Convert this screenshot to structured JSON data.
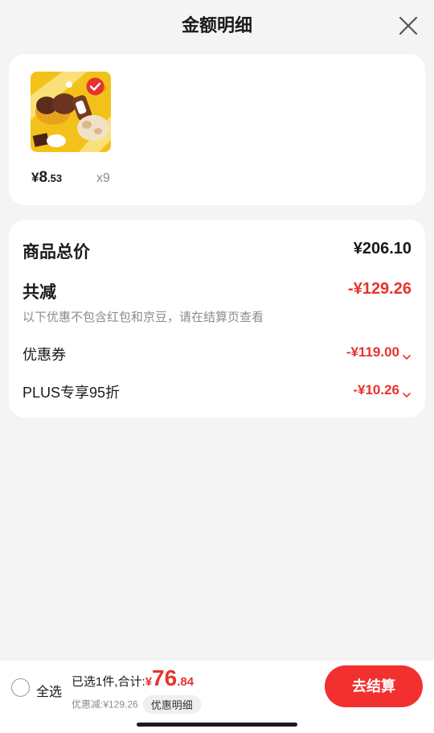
{
  "header": {
    "title": "金额明细",
    "close_icon": "close-icon"
  },
  "product": {
    "yuan_symbol": "¥",
    "price_int": "8",
    "price_dec": ".53",
    "quantity": "x9",
    "selected": true,
    "image_icon": "product-photo"
  },
  "summary": {
    "total_label": "商品总价",
    "total_value": "¥206.10",
    "discount_label": "共减",
    "discount_value": "-¥129.26",
    "discount_note": "以下优惠不包含红包和京豆，请在结算页查看",
    "coupon_label": "优惠券",
    "coupon_value": "-¥119.00",
    "plus_label": "PLUS专享95折",
    "plus_value": "-¥10.26"
  },
  "bottom_bar": {
    "select_all_label": "全选",
    "selected_text": "已选1件,合计:",
    "sum_yuan": "¥",
    "sum_int": "76",
    "sum_dec": ".84",
    "savings_text": "优惠减:¥129.26",
    "detail_pill": "优惠明细",
    "checkout_label": "去结算"
  },
  "colors": {
    "accent_red": "#e8322d",
    "checkout_red": "#f2302f",
    "background": "#f4f4f4",
    "card": "#ffffff"
  }
}
